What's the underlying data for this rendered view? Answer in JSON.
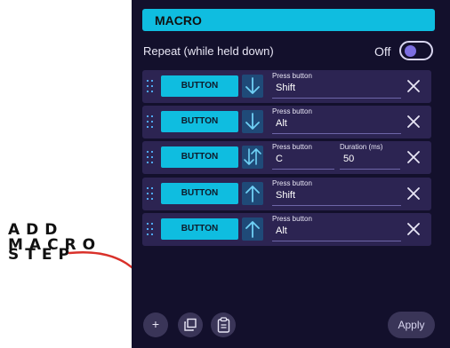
{
  "annotation": {
    "line1": "ADD MACRO",
    "line2": "STEP",
    "color": "#d9312a"
  },
  "panel": {
    "header": "MACRO",
    "repeat_label": "Repeat (while held down)",
    "toggle_state": "Off",
    "rows": [
      {
        "button": "BUTTON",
        "direction": "down",
        "field1_label": "Press button",
        "field1_value": "Shift"
      },
      {
        "button": "BUTTON",
        "direction": "down",
        "field1_label": "Press button",
        "field1_value": "Alt"
      },
      {
        "button": "BUTTON",
        "direction": "down-up",
        "field1_label": "Press button",
        "field1_value": "C",
        "field2_label": "Duration (ms)",
        "field2_value": "50"
      },
      {
        "button": "BUTTON",
        "direction": "up",
        "field1_label": "Press button",
        "field1_value": "Shift"
      },
      {
        "button": "BUTTON",
        "direction": "up",
        "field1_label": "Press button",
        "field1_value": "Alt"
      }
    ],
    "footer": {
      "add_icon": "+",
      "copy_icon": "copy-icon",
      "paste_icon": "clipboard-icon",
      "apply_label": "Apply"
    }
  },
  "colors": {
    "panel_bg": "#13102c",
    "accent": "#0fbde0",
    "row_bg": "#2c2452",
    "arrow_box": "#1f4a78"
  }
}
